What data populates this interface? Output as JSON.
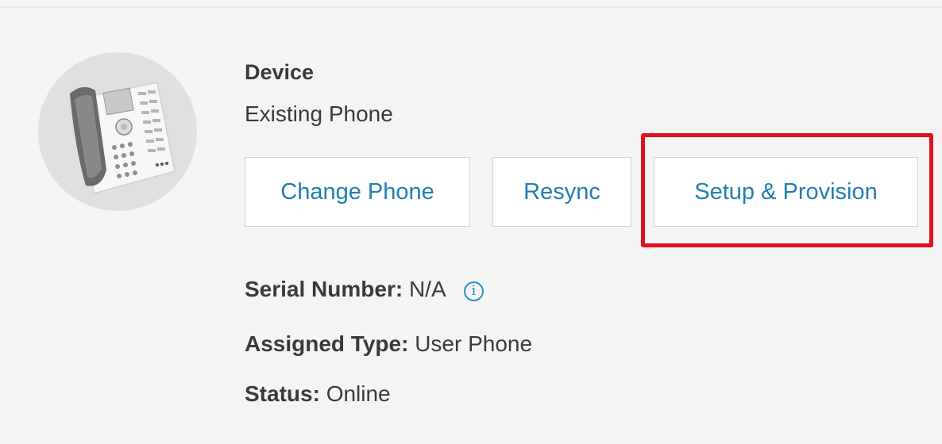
{
  "device": {
    "title": "Device",
    "subtitle": "Existing Phone",
    "image_icon": "desk-phone-icon"
  },
  "actions": {
    "change_phone": "Change Phone",
    "resync": "Resync",
    "setup_provision": "Setup & Provision"
  },
  "highlight": {
    "target": "setup-provision-button",
    "color": "#e0101e"
  },
  "fields": {
    "serial_label": "Serial Number:",
    "serial_value": "N/A",
    "info_icon": "i",
    "assigned_label": "Assigned Type:",
    "assigned_value": "User Phone",
    "status_label": "Status:",
    "status_value": "Online"
  },
  "colors": {
    "link_blue": "#1f7fb0",
    "info_blue": "#2a8fc7",
    "text": "#3a3a3a",
    "background": "#f4f4f4"
  }
}
